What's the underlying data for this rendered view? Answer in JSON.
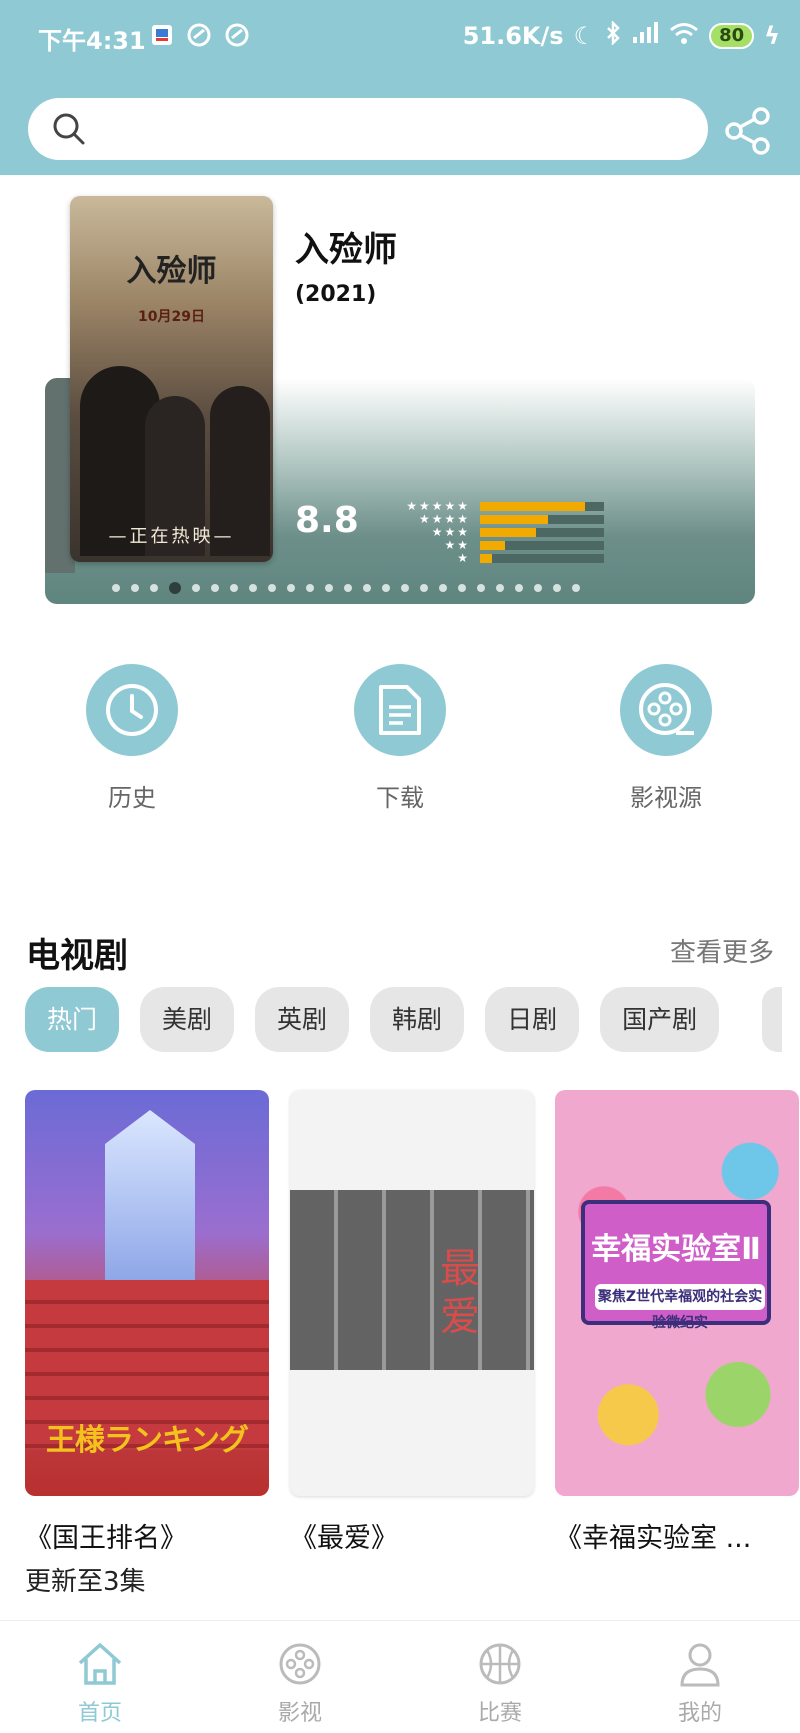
{
  "status": {
    "time": "下午4:31",
    "net_speed": "51.6K/s",
    "battery": "80"
  },
  "search": {
    "placeholder": ""
  },
  "banner": {
    "poster_title": "入殓师",
    "poster_date": "10月29日",
    "poster_footer": "—正在热映—",
    "title": "入殓师",
    "year": "(2021)",
    "score": "8.8",
    "rating_distribution": [
      0.85,
      0.55,
      0.45,
      0.2,
      0.1
    ],
    "slide_count": 25,
    "active_slide": 3
  },
  "actions": [
    {
      "label": "历史",
      "icon": "clock-icon"
    },
    {
      "label": "下载",
      "icon": "document-icon"
    },
    {
      "label": "影视源",
      "icon": "film-reel-icon"
    }
  ],
  "section": {
    "title": "电视剧",
    "more": "查看更多",
    "tabs": [
      "热门",
      "美剧",
      "英剧",
      "韩剧",
      "日剧",
      "国产剧"
    ],
    "active_tab": 0
  },
  "cards": [
    {
      "title": "《国王排名》",
      "subtitle": "更新至3集",
      "poster_text": "王様ランキング"
    },
    {
      "title": "《最爱》",
      "subtitle": "",
      "poster_text": "最爱"
    },
    {
      "title": "《幸福实验室 ...",
      "subtitle": "",
      "poster_text": "幸福实验室Ⅱ",
      "poster_sub": "聚焦Z世代幸福观的社会实验微纪实"
    }
  ],
  "nav": {
    "items": [
      {
        "label": "首页",
        "icon": "home-icon"
      },
      {
        "label": "影视",
        "icon": "film-icon"
      },
      {
        "label": "比赛",
        "icon": "basketball-icon"
      },
      {
        "label": "我的",
        "icon": "user-icon"
      }
    ],
    "active": 0
  },
  "colors": {
    "accent": "#8fc9d3",
    "rating_bar": "#f2a900",
    "banner_bottom": "#5f857f"
  }
}
